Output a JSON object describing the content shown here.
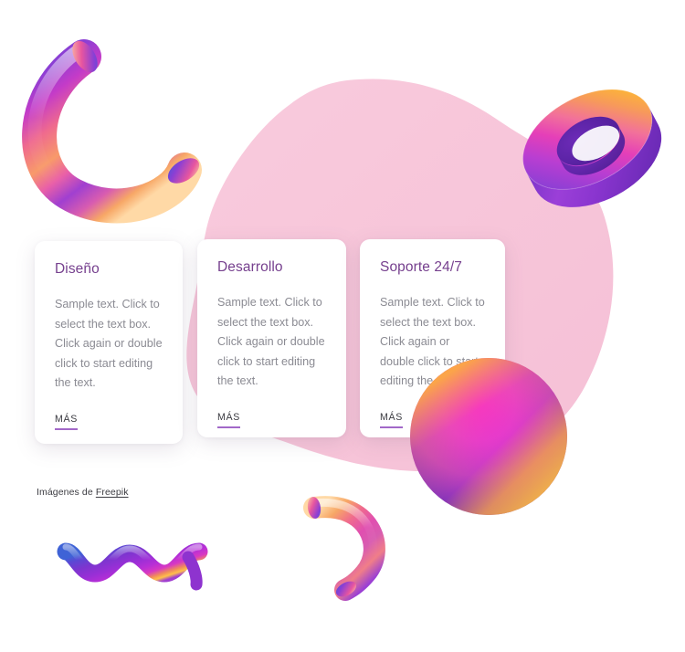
{
  "page": {
    "background_color": "#ffffff",
    "blob_color": "#f7c6da",
    "accent_purple": "#a268c8",
    "title_color": "#76408e",
    "body_text_color": "#8b8b93"
  },
  "cards": [
    {
      "title": "Diseño",
      "body": "Sample text. Click to select the text box. Click again or double click to start editing the text.",
      "link_label": "MÁS"
    },
    {
      "title": "Desarrollo",
      "body": "Sample text. Click to select the text box. Click again or double click to start editing the text.",
      "link_label": "MÁS"
    },
    {
      "title": "Soporte 24/7",
      "body": "Sample text. Click to select the text box. Click again or double click to start editing the text.",
      "link_label": "MÁS"
    }
  ],
  "credit": {
    "prefix": "Imágenes de ",
    "link_label": "Freepik"
  },
  "decorations": [
    {
      "name": "c-tube-top-left",
      "shape": "3d-gradient-arc-tube"
    },
    {
      "name": "torus-top-right",
      "shape": "3d-gradient-torus"
    },
    {
      "name": "pink-blob",
      "shape": "organic-blob"
    },
    {
      "name": "sphere-bottom-right",
      "shape": "3d-gradient-sphere"
    },
    {
      "name": "wave-ribbon-bottom-left",
      "shape": "3d-gradient-zigzag"
    },
    {
      "name": "c-tube-bottom-center",
      "shape": "3d-gradient-arc-tube-small"
    }
  ]
}
